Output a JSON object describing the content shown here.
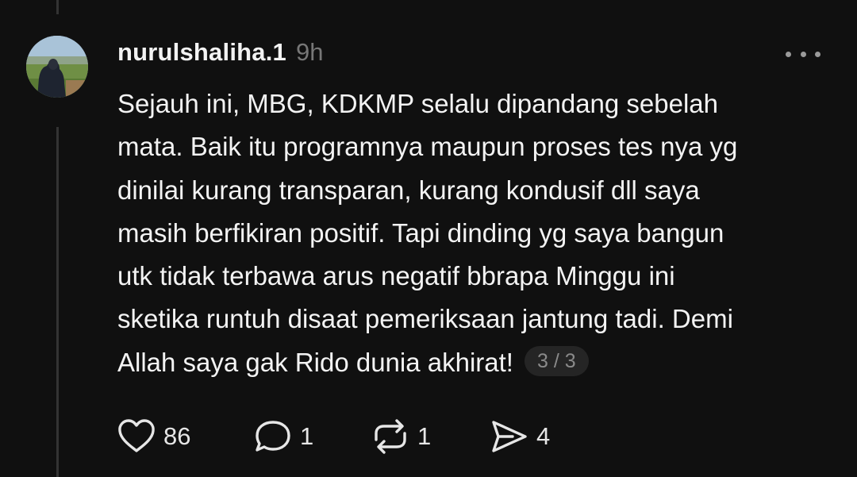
{
  "post": {
    "username": "nurulshaliha.1",
    "timestamp": "9h",
    "body_lines": [
      "Sejauh ini, MBG, KDKMP selalu dipandang sebelah",
      "mata. Baik itu programnya maupun proses tes nya yg",
      "dinilai kurang transparan, kurang kondusif dll saya",
      "masih berfikiran positif. Tapi dinding yg saya bangun",
      "utk tidak terbawa arus negatif bbrapa Minggu ini",
      "sketika runtuh disaat pemeriksaan jantung tadi. Demi",
      "Allah saya gak Rido dunia akhirat!"
    ],
    "thread_position": "3 / 3"
  },
  "actions": {
    "likes": "86",
    "replies": "1",
    "reposts": "1",
    "shares": "4"
  },
  "icons": {
    "more": "more-dots-icon",
    "like": "heart-icon",
    "reply": "comment-bubble-icon",
    "repost": "repost-arrows-icon",
    "share": "send-arrow-icon"
  },
  "colors": {
    "background": "#101010",
    "text": "#f3f3f3",
    "muted": "#777777",
    "pill": "#252525"
  }
}
